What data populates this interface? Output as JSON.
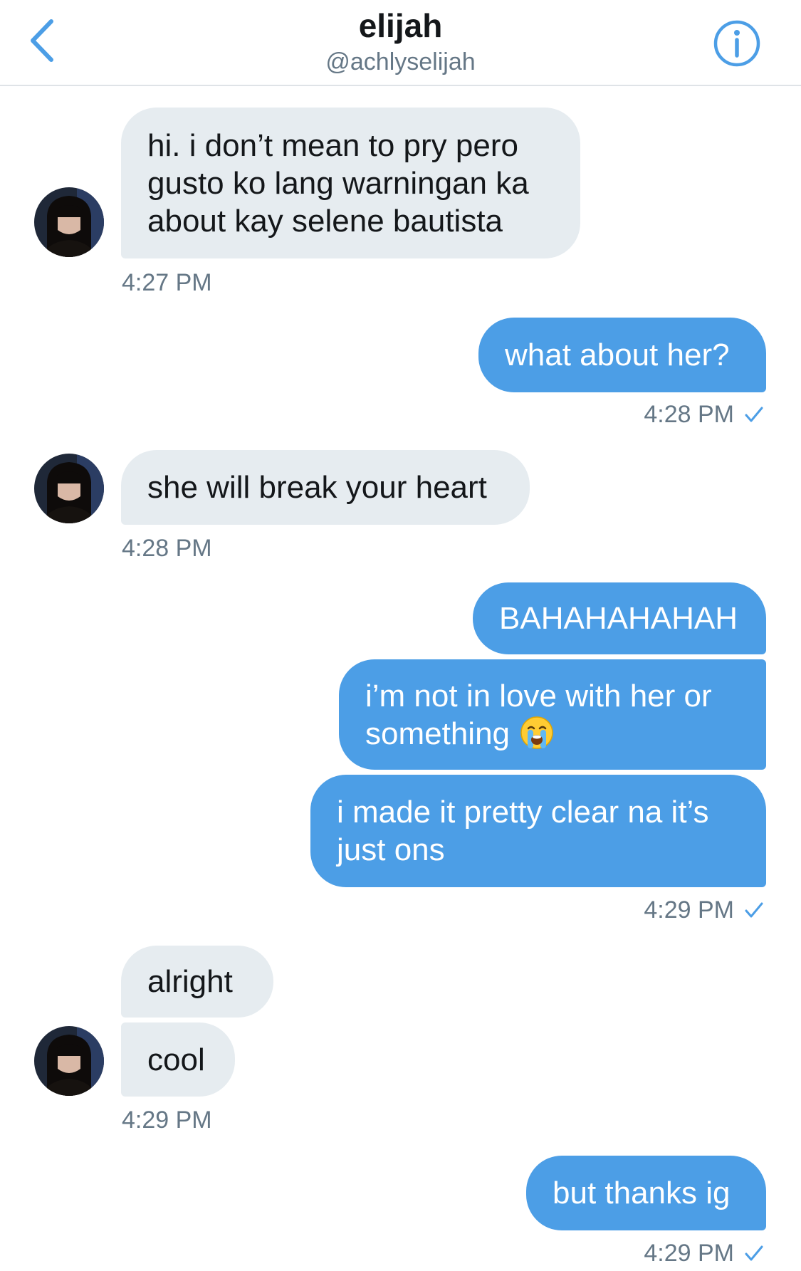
{
  "header": {
    "name": "elijah",
    "handle": "@achlyselijah"
  },
  "messages": [
    {
      "text": "hi. i don’t mean to pry pero\ngusto ko lang warningan ka\nabout kay selene bautista",
      "time": "4:27 PM"
    },
    {
      "text": "what about her?",
      "time": "4:28 PM"
    },
    {
      "text": "she will break your heart",
      "time": "4:28 PM"
    },
    {
      "text": "BAHAHAHAHAH"
    },
    {
      "text": "i’m not in love with her or\nsomething",
      "emoji": "loudly-crying-face"
    },
    {
      "text": "i made it pretty clear na it’s\njust ons",
      "time": "4:29 PM"
    },
    {
      "text": "alright"
    },
    {
      "text": "cool",
      "time": "4:29 PM"
    },
    {
      "text": "but thanks ig",
      "time": "4:29 PM"
    }
  ],
  "icons": {
    "back": "chevron-left-icon",
    "info": "info-icon",
    "read_receipt": "checkmark-icon"
  },
  "colors": {
    "outgoing_bubble": "#4c9ee6",
    "incoming_bubble": "#e6ecf0",
    "accent": "#1da1f2",
    "muted_text": "#657786"
  }
}
